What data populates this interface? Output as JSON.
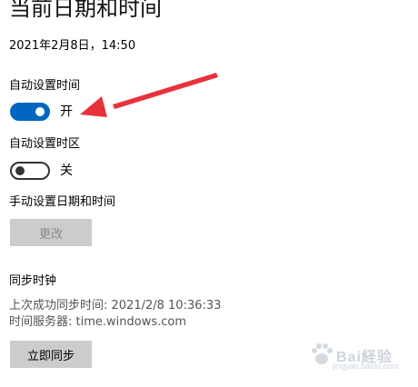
{
  "page": {
    "title": "当前日期和时间",
    "current_datetime": "2021年2月8日，14:50"
  },
  "auto_time": {
    "label": "自动设置时间",
    "state_label": "开",
    "enabled": true
  },
  "auto_timezone": {
    "label": "自动设置时区",
    "state_label": "关",
    "enabled": false
  },
  "manual": {
    "label": "手动设置日期和时间",
    "change_button": "更改"
  },
  "sync": {
    "title": "同步时钟",
    "last_sync": "上次成功同步时间: 2021/2/8 10:36:33",
    "server": "时间服务器: time.windows.com",
    "sync_button": "立即同步"
  },
  "watermark": {
    "text": "Bai経验",
    "url": "jingyan.baidu.com"
  },
  "colors": {
    "accent": "#0067c0",
    "annotation_arrow": "#e8323b",
    "button_bg": "#cccccc"
  }
}
